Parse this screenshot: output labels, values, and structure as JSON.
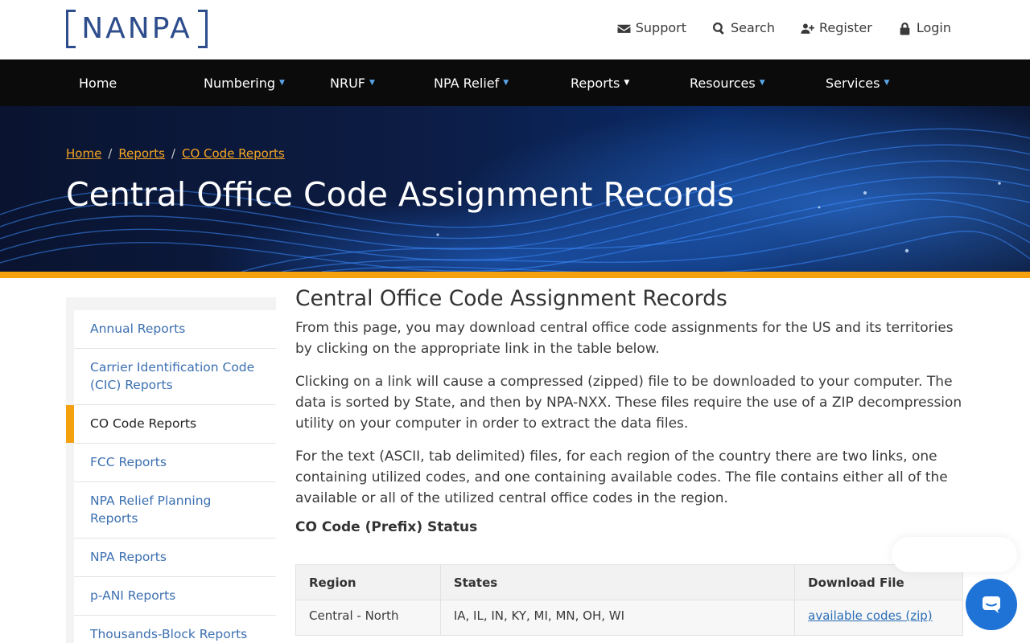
{
  "logo": {
    "text": "NANPA"
  },
  "utility": [
    {
      "label": "Support",
      "icon": "envelope-icon"
    },
    {
      "label": "Search",
      "icon": "search-icon"
    },
    {
      "label": "Register",
      "icon": "user-plus-icon"
    },
    {
      "label": "Login",
      "icon": "lock-icon"
    }
  ],
  "nav": [
    {
      "label": "Home",
      "dropdown": false
    },
    {
      "label": "Numbering",
      "dropdown": true
    },
    {
      "label": "NRUF",
      "dropdown": true
    },
    {
      "label": "NPA Relief",
      "dropdown": true
    },
    {
      "label": "Reports",
      "dropdown": true
    },
    {
      "label": "Resources",
      "dropdown": true
    },
    {
      "label": "Services",
      "dropdown": true
    }
  ],
  "breadcrumb": [
    "Home",
    "Reports",
    "CO Code Reports"
  ],
  "hero": {
    "title": "Central Office Code Assignment Records"
  },
  "sidebar": {
    "items": [
      {
        "label": "Annual Reports",
        "active": false
      },
      {
        "label": "Carrier Identification Code (CIC) Reports",
        "active": false
      },
      {
        "label": "CO Code Reports",
        "active": true
      },
      {
        "label": "FCC Reports",
        "active": false
      },
      {
        "label": "NPA Relief Planning Reports",
        "active": false
      },
      {
        "label": "NPA Reports",
        "active": false
      },
      {
        "label": "p-ANI Reports",
        "active": false
      },
      {
        "label": "Thousands-Block Reports",
        "active": false
      }
    ]
  },
  "content": {
    "title": "Central Office Code Assignment Records",
    "paragraphs": [
      "From this page, you may download central office code assignments for the US and its territories by clicking on the appropriate link in the table below.",
      "Clicking on a link will cause a compressed (zipped) file to be downloaded to your computer. The data is sorted by State, and then by NPA-NXX. These files require the use of a ZIP decompression utility on your computer in order to extract the data files.",
      "For the text (ASCII, tab delimited) files, for each region of the country there are two links, one containing utilized codes, and one containing available codes. The file contains either all of the available or all of the utilized central office codes in the region."
    ],
    "section_heading": "CO Code (Prefix) Status"
  },
  "table": {
    "headers": [
      "Region",
      "States",
      "Download File"
    ],
    "rows": [
      {
        "region": "Central - North",
        "states": "IA, IL, IN, KY, MI, MN, OH, WI",
        "download": "available codes (zip)"
      }
    ]
  },
  "colors": {
    "accent": "#f5a00f",
    "link": "#3b6fb0",
    "nav_bg": "#0b0b0b",
    "chat": "#1f73d6"
  },
  "chat": {
    "icon": "chat-icon"
  }
}
